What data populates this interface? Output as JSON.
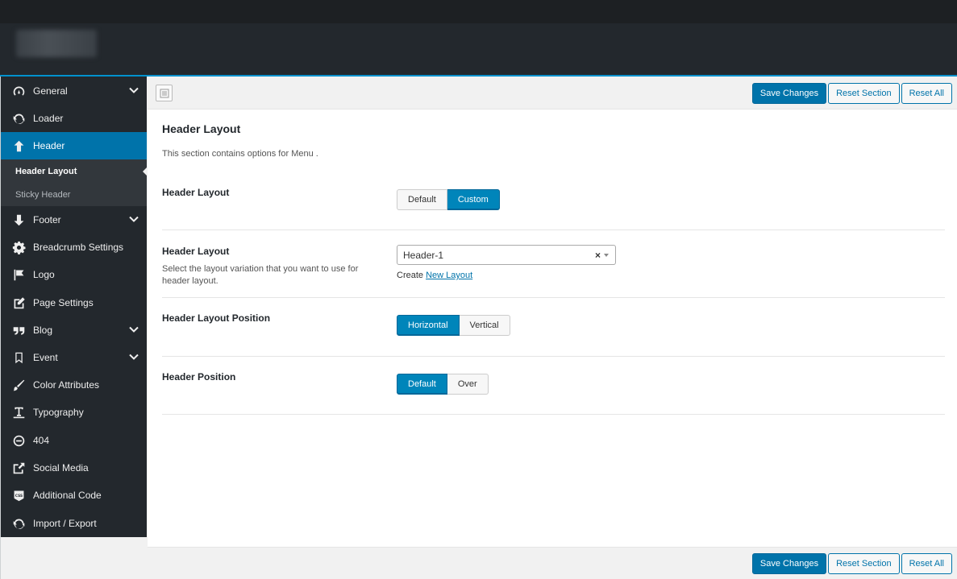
{
  "sidebar": {
    "items": [
      {
        "label": "General",
        "icon": "dashboard-icon",
        "has_children": true
      },
      {
        "label": "Loader",
        "icon": "refresh-icon",
        "has_children": false
      },
      {
        "label": "Header",
        "icon": "arrow-up-icon",
        "has_children": false,
        "active": true
      },
      {
        "label": "Footer",
        "icon": "arrow-down-icon",
        "has_children": true
      },
      {
        "label": "Breadcrumb Settings",
        "icon": "gear-icon",
        "has_children": false
      },
      {
        "label": "Logo",
        "icon": "flag-icon",
        "has_children": false
      },
      {
        "label": "Page Settings",
        "icon": "edit-icon",
        "has_children": false
      },
      {
        "label": "Blog",
        "icon": "quote-icon",
        "has_children": true
      },
      {
        "label": "Event",
        "icon": "bookmark-icon",
        "has_children": true
      },
      {
        "label": "Color Attributes",
        "icon": "brush-icon",
        "has_children": false
      },
      {
        "label": "Typography",
        "icon": "text-icon",
        "has_children": false
      },
      {
        "label": "404",
        "icon": "minus-circle-icon",
        "has_children": false
      },
      {
        "label": "Social Media",
        "icon": "share-icon",
        "has_children": false
      },
      {
        "label": "Additional Code",
        "icon": "css-icon",
        "has_children": false
      },
      {
        "label": "Import / Export",
        "icon": "refresh-icon",
        "has_children": false
      }
    ],
    "submenu": [
      {
        "label": "Header Layout",
        "current": true
      },
      {
        "label": "Sticky Header",
        "current": false
      }
    ]
  },
  "toolbar": {
    "save_label": "Save Changes",
    "reset_section_label": "Reset Section",
    "reset_all_label": "Reset All"
  },
  "section": {
    "title": "Header Layout",
    "description": "This section contains options for Menu ."
  },
  "options": {
    "layout_mode": {
      "label": "Header Layout",
      "choices": [
        "Default",
        "Custom"
      ],
      "selected": "Custom"
    },
    "layout_select": {
      "label": "Header Layout",
      "subtitle": "Select the layout variation that you want to use for header layout.",
      "value": "Header-1",
      "clear_symbol": "×",
      "create_prefix": "Create",
      "create_link": "New Layout"
    },
    "layout_position": {
      "label": "Header Layout Position",
      "choices": [
        "Horizontal",
        "Vertical"
      ],
      "selected": "Horizontal"
    },
    "header_position": {
      "label": "Header Position",
      "choices": [
        "Default",
        "Over"
      ],
      "selected": "Default"
    }
  },
  "colors": {
    "accent": "#0073aa",
    "sidebar_bg": "#23282d",
    "submenu_bg": "#32373c",
    "header_border": "#0091cd"
  }
}
